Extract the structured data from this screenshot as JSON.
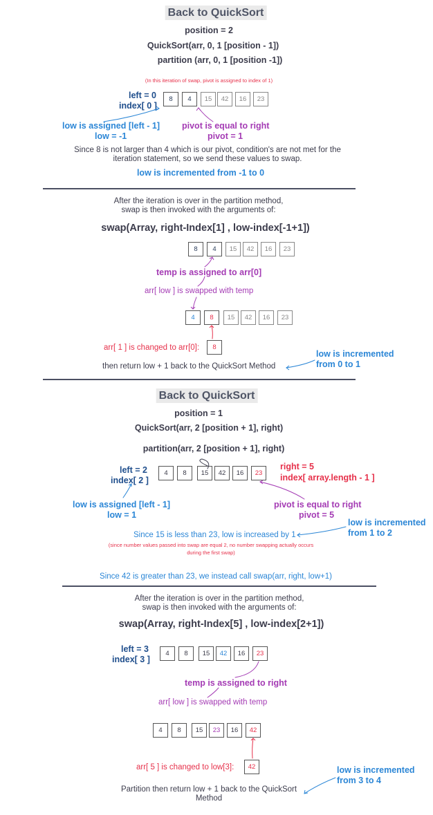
{
  "s1": {
    "title": "Back to QuickSort",
    "position": "position = 2",
    "call": "QuickSort(arr, 0, 1 [position - 1])",
    "partition": "partition (arr, 0, 1 [position -1])",
    "note": "(In this iteration of swap, pivot is assigned to index of 1)",
    "left": "left = 0",
    "index": "index[ 0 ]",
    "array": [
      "8",
      "4",
      "15",
      "42",
      "16",
      "23"
    ],
    "low_assigned": "low is assigned [left - 1]",
    "low_val": "low = -1",
    "pivot_eq": "pivot is equal to right",
    "pivot_val": "pivot = 1",
    "explain": "Since 8 is not larger than 4 which is our pivot, condition's are not met for the iteration statement, so we send these values to swap.",
    "low_inc": "low is incremented from -1 to 0"
  },
  "s2": {
    "intro1": "After the iteration is over in the partition method,",
    "intro2": "swap is then invoked with the arguments of:",
    "swap": "swap(Array, right-Index[1] , low-index[-1+1])",
    "array_before": [
      "8",
      "4",
      "15",
      "42",
      "16",
      "23"
    ],
    "temp": "temp is assigned to arr[0]",
    "swapped": "arr[ low ] is swapped with temp",
    "array_after": [
      "4",
      "8",
      "15",
      "42",
      "16",
      "23"
    ],
    "changed": "arr[ 1 ] is changed to arr[0]:",
    "changed_val": "8",
    "ret": "then return low + 1 back to the QuickSort Method",
    "low_inc1": "low is incremented",
    "low_inc2": "from 0 to 1"
  },
  "s3": {
    "title": "Back to QuickSort",
    "position": "position = 1",
    "call": "QuickSort(arr, 2 [position + 1], right)",
    "partition": "partition(arr, 2 [position + 1], right)",
    "left": "left = 2",
    "index": "index[ 2 ]",
    "array": [
      "4",
      "8",
      "15",
      "42",
      "16",
      "23"
    ],
    "right": "right = 5",
    "index_right": "index[ array.length - 1 ]",
    "low_assigned": "low is assigned [left - 1]",
    "low_val": "low = 1",
    "pivot_eq": "pivot is equal to right",
    "pivot_val": "pivot = 5",
    "low_inc1": "low is incremented",
    "low_inc2": "from 1 to 2",
    "explain": "Since 15 is less than 23, low is increased by 1",
    "note1": "(since number values passed into swap are equal 2, no number swapping actually occurs",
    "note2": "during the first swap)",
    "explain2": "Since 42 is greater than 23, we instead call swap(arr, right, low+1)"
  },
  "s4": {
    "intro1": "After the iteration is over in the partition method,",
    "intro2": "swap is then invoked with the arguments of:",
    "swap": "swap(Array, right-Index[5] , low-index[2+1])",
    "left": "left = 3",
    "index": "index[ 3 ]",
    "array_before": [
      "4",
      "8",
      "15",
      "42",
      "16",
      "23"
    ],
    "temp": "temp is assigned to right",
    "swapped": "arr[ low ] is swapped with temp",
    "array_after": [
      "4",
      "8",
      "15",
      "23",
      "16",
      "42"
    ],
    "changed": "arr[ 5 ] is changed to low[3]:",
    "changed_val": "42",
    "ret1": "Partition then return low + 1 back to the QuickSort",
    "ret2": "Method",
    "low_inc1": "low is incremented",
    "low_inc2": "from 3 to 4"
  },
  "colors": {
    "blue": "#2b86d6",
    "purple": "#a43bb4",
    "red": "#e6304a",
    "navy": "#1f4e8c",
    "rule": "#4b4f62"
  }
}
